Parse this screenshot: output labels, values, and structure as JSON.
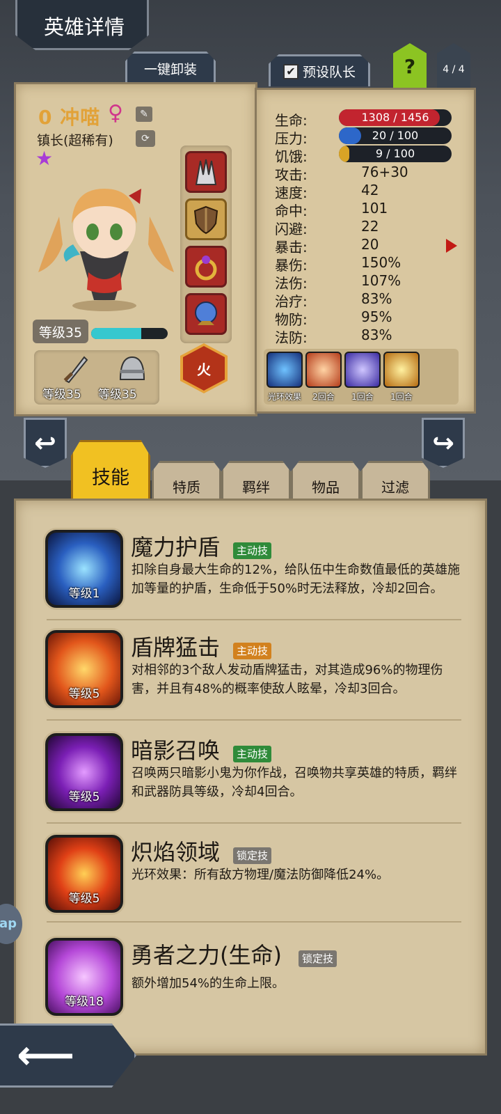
{
  "header": {
    "title": "英雄详情",
    "unequip_all": "一键卸装",
    "preset_captain": "预设队长",
    "help": "?",
    "page": "4 / 4"
  },
  "hero": {
    "name": "0 冲喵",
    "gender_symbol": "♀",
    "class_label": "镇长(超稀有)",
    "stars": 1,
    "level_label": "等级35",
    "xp_fraction": 0.65,
    "weapon_level": "等级35",
    "armor_level": "等级35",
    "element": "火"
  },
  "stats": {
    "hp": {
      "label": "生命:",
      "value": "1308 / 1456",
      "fraction": 0.898
    },
    "stress": {
      "label": "压力:",
      "value": "20 / 100",
      "fraction": 0.2
    },
    "hunger": {
      "label": "饥饿:",
      "value": "9 / 100",
      "fraction": 0.09
    },
    "list": [
      {
        "label": "攻击:",
        "value": "76+30"
      },
      {
        "label": "速度:",
        "value": "42"
      },
      {
        "label": "命中:",
        "value": "101"
      },
      {
        "label": "闪避:",
        "value": "22"
      },
      {
        "label": "暴击:",
        "value": "20"
      },
      {
        "label": "暴伤:",
        "value": "150%"
      },
      {
        "label": "法伤:",
        "value": "107%"
      },
      {
        "label": "治疗:",
        "value": "83%"
      },
      {
        "label": "物防:",
        "value": "95%"
      },
      {
        "label": "法防:",
        "value": "83%"
      }
    ]
  },
  "buffs": [
    "光环效果",
    "2回合",
    "1回合",
    "1回合"
  ],
  "tabs": [
    "技能",
    "特质",
    "羁绊",
    "物品",
    "过滤"
  ],
  "skills": [
    {
      "name": "魔力护盾",
      "tag": "主动技",
      "tag_color": "#2f8b3a",
      "level": "等级1",
      "desc": "扣除自身最大生命的12%，给队伍中生命数值最低的英雄施加等量的护盾，生命低于50%时无法释放，冷却2回合。"
    },
    {
      "name": "盾牌猛击",
      "tag": "主动技",
      "tag_color": "#d2811e",
      "level": "等级5",
      "desc": "对相邻的3个敌人发动盾牌猛击，对其造成96%的物理伤害，并且有48%的概率使敌人眩晕，冷却3回合。"
    },
    {
      "name": "暗影召唤",
      "tag": "主动技",
      "tag_color": "#2f8b3a",
      "level": "等级5",
      "desc": "召唤两只暗影小鬼为你作战，召唤物共享英雄的特质，羁绊和武器防具等级，冷却4回合。"
    },
    {
      "name": "炽焰领域",
      "tag": "锁定技",
      "tag_color": "#7a7670",
      "level": "等级5",
      "desc": "光环效果：所有敌方物理/魔法防御降低24%。"
    },
    {
      "name": "勇者之力(生命)",
      "tag": "锁定技",
      "tag_color": "#7a7670",
      "level": "等级18",
      "desc": "额外增加54%的生命上限。"
    }
  ],
  "side_label": "ap",
  "colors": {
    "hp": "#c2242f",
    "stress": "#2d67c9",
    "hunger": "#d9a426",
    "xp": "#36c8cf",
    "active_tab": "#f1c122"
  }
}
